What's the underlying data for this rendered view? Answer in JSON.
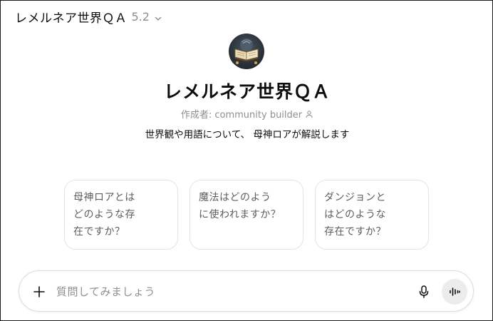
{
  "header": {
    "title": "レメルネア世界ＱＡ",
    "version": "5.2"
  },
  "gpt": {
    "title": "レメルネア世界ＱＡ",
    "creator": "作成者: community builder",
    "description": "世界観や用語について、 母神ロアが解説します"
  },
  "starters": [
    "母神ロアとは\nどのような存\n在ですか？",
    "魔法はどのよう\nに使われますか？",
    "ダンジョンと\nはどのような\n存在ですか？"
  ],
  "composer": {
    "placeholder": "質問してみましょう"
  },
  "icons": {
    "header_chevron": "chevron-down-icon",
    "creator": "person-icon",
    "avatar": "open-book-icon",
    "attach": "plus-icon",
    "mic": "microphone-icon",
    "voice": "voice-waveform-icon"
  }
}
